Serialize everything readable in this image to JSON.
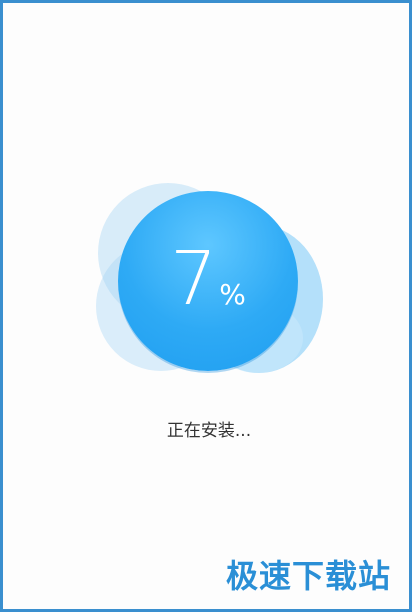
{
  "progress": {
    "percent_value": 7,
    "number_text": "7",
    "unit_text": "%"
  },
  "status": {
    "text": "正在安装..."
  },
  "watermark": {
    "text": "极速下载站"
  },
  "colors": {
    "border": "#3a8fcf",
    "accent": "#2eaaf5",
    "text": "#333333"
  }
}
